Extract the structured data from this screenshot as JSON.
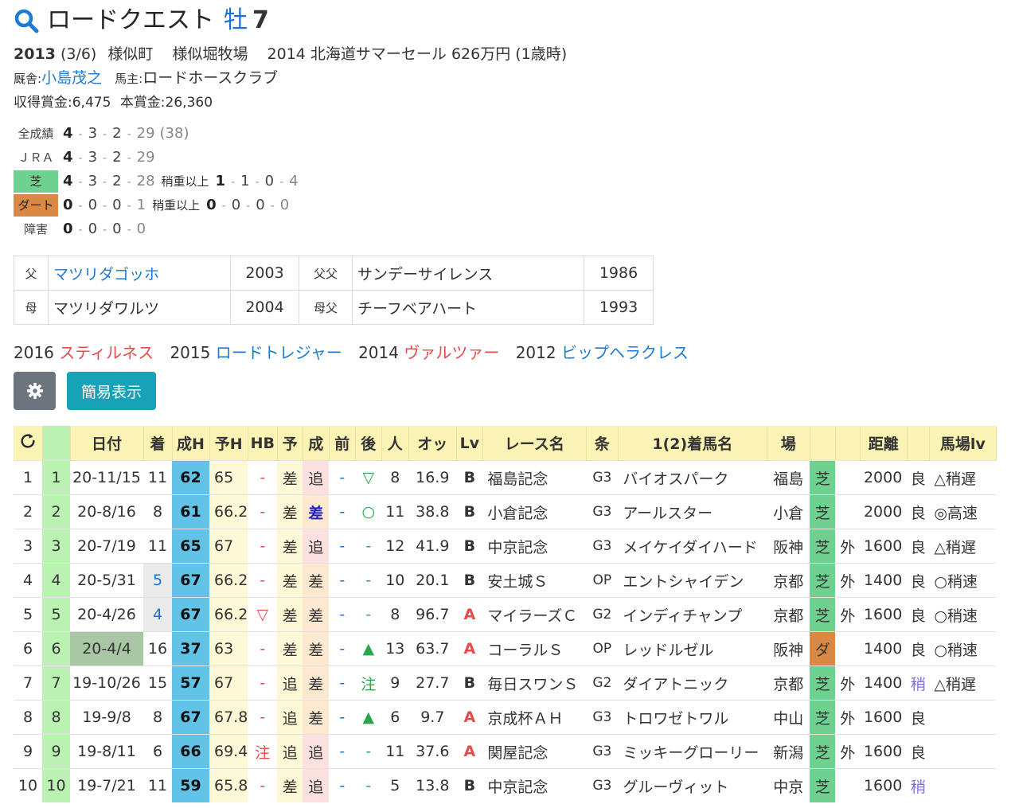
{
  "horse": {
    "name": "ロードクエスト",
    "sex_age": "牡",
    "age": "7"
  },
  "profile": {
    "birth_year": "2013",
    "birth_date": "(3/6)",
    "region": "様似町",
    "breeder": "様似堀牧場",
    "sale": "2014 北海道サマーセール 626万円 (1歳時)",
    "trainer_label": "厩舎:",
    "trainer": "小島茂之",
    "owner_label": "馬主:",
    "owner": "ロードホースクラブ",
    "earnings": "収得賞金:6,475",
    "prize": "本賞金:26,360"
  },
  "records": [
    {
      "label": "全成績",
      "w": "4",
      "s": "3",
      "t": "2",
      "o": "29",
      "extra": "(38)"
    },
    {
      "label": "ＪＲＡ",
      "w": "4",
      "s": "3",
      "t": "2",
      "o": "29"
    },
    {
      "label": "芝",
      "w": "4",
      "s": "3",
      "t": "2",
      "o": "28",
      "heavy_label": "稍重以上",
      "hw": "1",
      "hs": "1",
      "ht": "0",
      "ho": "4"
    },
    {
      "label": "ダート",
      "w": "0",
      "s": "0",
      "t": "0",
      "o": "1",
      "heavy_label": "稍重以上",
      "hw": "0",
      "hs": "0",
      "ht": "0",
      "ho": "0"
    },
    {
      "label": "障害",
      "w": "0",
      "s": "0",
      "t": "0",
      "o": "0"
    }
  ],
  "pedigree": {
    "sire_label": "父",
    "sire": "マツリダゴッホ",
    "sire_year": "2003",
    "sire_sire_label": "父父",
    "sire_sire": "サンデーサイレンス",
    "sire_sire_year": "1986",
    "dam_label": "母",
    "dam": "マツリダワルツ",
    "dam_year": "2004",
    "dam_sire_label": "母父",
    "dam_sire": "チーフベアハート",
    "dam_sire_year": "1993"
  },
  "siblings": [
    {
      "year": "2016",
      "name": "スティルネス",
      "color": "#e84b4b"
    },
    {
      "year": "2015",
      "name": "ロードトレジャー",
      "color": "#1e7ad4"
    },
    {
      "year": "2014",
      "name": "ヴァルツァー",
      "color": "#e84b4b"
    },
    {
      "year": "2012",
      "name": "ビップヘラクレス",
      "color": "#1e7ad4"
    }
  ],
  "buttons": {
    "gear_icon": "gear-icon",
    "simple_view": "簡易表示"
  },
  "table": {
    "headers": [
      "",
      "",
      "日付",
      "着",
      "成H",
      "予H",
      "HB",
      "予",
      "成",
      "前",
      "後",
      "人",
      "オッ",
      "Lv",
      "レース名",
      "条",
      "1(2)着馬名",
      "場",
      "",
      "",
      "距離",
      "",
      "馬場lv"
    ],
    "rows": [
      [
        "1",
        "1",
        "20-11/15",
        "11",
        "62",
        "65",
        "-",
        "差",
        "追",
        "-",
        "▽",
        "8",
        "16.9",
        "B",
        "福島記念",
        "G3",
        "バイオスパーク",
        "福島",
        "芝",
        "",
        "2000",
        "良",
        "△稍遅"
      ],
      [
        "2",
        "2",
        "20-8/16",
        "8",
        "61",
        "66.2",
        "-",
        "差",
        "差",
        "-",
        "○",
        "11",
        "38.8",
        "B",
        "小倉記念",
        "G3",
        "アールスター",
        "小倉",
        "芝",
        "",
        "2000",
        "良",
        "◎高速"
      ],
      [
        "3",
        "3",
        "20-7/19",
        "11",
        "65",
        "67",
        "-",
        "差",
        "追",
        "-",
        "-",
        "12",
        "41.9",
        "B",
        "中京記念",
        "G3",
        "メイケイダイハード",
        "阪神",
        "芝",
        "外",
        "1600",
        "良",
        "△稍遅"
      ],
      [
        "4",
        "4",
        "20-5/31",
        "5",
        "67",
        "66.2",
        "-",
        "差",
        "差",
        "-",
        "-",
        "10",
        "20.1",
        "B",
        "安土城Ｓ",
        "OP",
        "エントシャイデン",
        "京都",
        "芝",
        "外",
        "1400",
        "良",
        "○稍速"
      ],
      [
        "5",
        "5",
        "20-4/26",
        "4",
        "67",
        "66.2",
        "▽",
        "差",
        "差",
        "-",
        "-",
        "8",
        "96.7",
        "A",
        "マイラーズＣ",
        "G2",
        "インディチャンプ",
        "京都",
        "芝",
        "外",
        "1600",
        "良",
        "○稍速"
      ],
      [
        "6",
        "6",
        "20-4/4",
        "16",
        "37",
        "63",
        "-",
        "差",
        "差",
        "-",
        "▲",
        "13",
        "63.7",
        "A",
        "コーラルＳ",
        "OP",
        "レッドルゼル",
        "阪神",
        "ダ",
        "",
        "1400",
        "良",
        "○稍速"
      ],
      [
        "7",
        "7",
        "19-10/26",
        "15",
        "57",
        "67",
        "-",
        "追",
        "差",
        "-",
        "注",
        "9",
        "27.7",
        "B",
        "毎日スワンＳ",
        "G2",
        "ダイアトニック",
        "京都",
        "芝",
        "外",
        "1400",
        "稍",
        "△稍遅"
      ],
      [
        "8",
        "8",
        "19-9/8",
        "8",
        "67",
        "67.8",
        "-",
        "追",
        "差",
        "-",
        "▲",
        "6",
        "9.7",
        "A",
        "京成杯ＡＨ",
        "G3",
        "トロワゼトワル",
        "中山",
        "芝",
        "外",
        "1600",
        "良",
        ""
      ],
      [
        "9",
        "9",
        "19-8/11",
        "6",
        "66",
        "69.4",
        "注",
        "追",
        "追",
        "-",
        "-",
        "11",
        "37.6",
        "A",
        "関屋記念",
        "G3",
        "ミッキーグローリー",
        "新潟",
        "芝",
        "外",
        "1600",
        "良",
        ""
      ],
      [
        "10",
        "10",
        "19-7/21",
        "11",
        "59",
        "65.8",
        "-",
        "差",
        "追",
        "-",
        "-",
        "5",
        "13.8",
        "B",
        "中京記念",
        "G3",
        "グルーヴィット",
        "中京",
        "芝",
        "",
        "1600",
        "稍",
        ""
      ]
    ]
  }
}
